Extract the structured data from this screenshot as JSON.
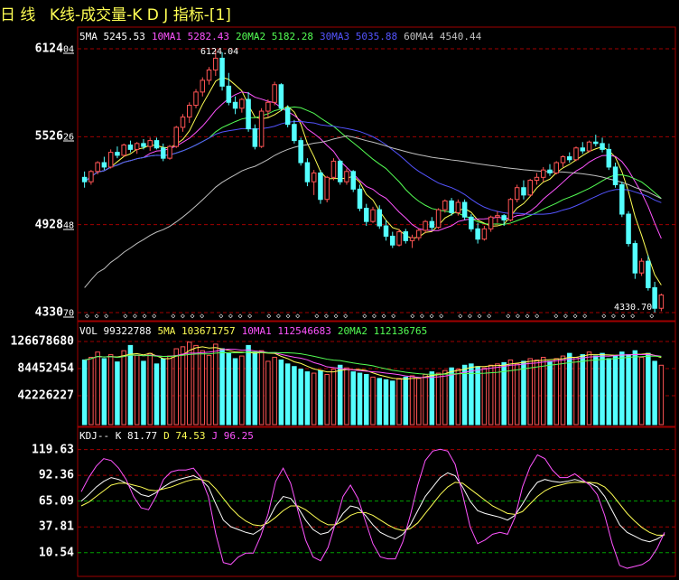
{
  "header": {
    "period": "日 线",
    "title": "K线-成交量-K D J 指标-[1]"
  },
  "price_legend": [
    {
      "text": "5MA 5245.53",
      "color": "#ffffff"
    },
    {
      "text": "10MA1 5282.43",
      "color": "#ff54ff"
    },
    {
      "text": "20MA2 5182.28",
      "color": "#54ff54"
    },
    {
      "text": "30MA3 5035.88",
      "color": "#5454ff"
    },
    {
      "text": "60MA4 4540.44",
      "color": "#c0c0c0"
    }
  ],
  "volume_legend": [
    {
      "text": "VOL 99322788",
      "color": "#ffffff"
    },
    {
      "text": "5MA 103671757",
      "color": "#ffff54"
    },
    {
      "text": "10MA1 112546683",
      "color": "#ff54ff"
    },
    {
      "text": "20MA2 112136765",
      "color": "#54ff54"
    }
  ],
  "kdj_legend": [
    {
      "text": "KDJ-- K 81.77",
      "color": "#ffffff"
    },
    {
      "text": "D 74.53",
      "color": "#ffff54"
    },
    {
      "text": "J 96.25",
      "color": "#ff54ff"
    }
  ],
  "price_axis": [
    {
      "main": "6124",
      "sub": "04"
    },
    {
      "main": "5526",
      "sub": "26"
    },
    {
      "main": "4928",
      "sub": "48"
    },
    {
      "main": "4330",
      "sub": "70"
    }
  ],
  "volume_axis": [
    "126678680",
    "84452454",
    "42226227"
  ],
  "kdj_axis": [
    "119.63",
    "92.36",
    "65.09",
    "37.81",
    "10.54"
  ],
  "annotations": {
    "high": "6124.04",
    "low": "4330.70"
  },
  "chart_data": [
    {
      "type": "candlestick",
      "title": "K线",
      "ylim": [
        4330.7,
        6124.04
      ],
      "ohlc": [
        [
          5250,
          5290,
          5180,
          5220
        ],
        [
          5220,
          5300,
          5200,
          5290
        ],
        [
          5290,
          5360,
          5270,
          5350
        ],
        [
          5350,
          5390,
          5300,
          5320
        ],
        [
          5320,
          5440,
          5310,
          5420
        ],
        [
          5420,
          5460,
          5380,
          5400
        ],
        [
          5400,
          5480,
          5390,
          5470
        ],
        [
          5470,
          5500,
          5420,
          5440
        ],
        [
          5440,
          5490,
          5410,
          5480
        ],
        [
          5480,
          5510,
          5440,
          5460
        ],
        [
          5460,
          5520,
          5430,
          5500
        ],
        [
          5500,
          5520,
          5440,
          5450
        ],
        [
          5450,
          5480,
          5360,
          5380
        ],
        [
          5380,
          5470,
          5370,
          5460
        ],
        [
          5460,
          5600,
          5450,
          5590
        ],
        [
          5590,
          5680,
          5560,
          5660
        ],
        [
          5660,
          5760,
          5620,
          5740
        ],
        [
          5740,
          5850,
          5720,
          5830
        ],
        [
          5830,
          5930,
          5800,
          5910
        ],
        [
          5910,
          6000,
          5880,
          5980
        ],
        [
          5980,
          6124.04,
          5940,
          6060
        ],
        [
          6060,
          6100,
          5840,
          5870
        ],
        [
          5870,
          5960,
          5740,
          5760
        ],
        [
          5760,
          5800,
          5680,
          5720
        ],
        [
          5720,
          5790,
          5690,
          5780
        ],
        [
          5780,
          5830,
          5560,
          5580
        ],
        [
          5580,
          5610,
          5440,
          5460
        ],
        [
          5460,
          5720,
          5450,
          5700
        ],
        [
          5700,
          5780,
          5660,
          5760
        ],
        [
          5760,
          5900,
          5740,
          5880
        ],
        [
          5880,
          5890,
          5700,
          5720
        ],
        [
          5720,
          5740,
          5590,
          5610
        ],
        [
          5610,
          5640,
          5480,
          5500
        ],
        [
          5500,
          5520,
          5330,
          5350
        ],
        [
          5350,
          5380,
          5190,
          5220
        ],
        [
          5220,
          5300,
          5130,
          5280
        ],
        [
          5280,
          5300,
          5070,
          5100
        ],
        [
          5100,
          5260,
          5080,
          5250
        ],
        [
          5250,
          5380,
          5230,
          5360
        ],
        [
          5360,
          5370,
          5200,
          5220
        ],
        [
          5220,
          5310,
          5200,
          5290
        ],
        [
          5290,
          5300,
          5150,
          5170
        ],
        [
          5170,
          5200,
          5020,
          5040
        ],
        [
          5040,
          5070,
          4920,
          4950
        ],
        [
          4950,
          5050,
          4940,
          5030
        ],
        [
          5030,
          5060,
          4900,
          4920
        ],
        [
          4920,
          4960,
          4820,
          4850
        ],
        [
          4850,
          4880,
          4770,
          4790
        ],
        [
          4790,
          4900,
          4780,
          4880
        ],
        [
          4880,
          4900,
          4800,
          4820
        ],
        [
          4820,
          4860,
          4770,
          4840
        ],
        [
          4840,
          4900,
          4820,
          4890
        ],
        [
          4890,
          4960,
          4870,
          4950
        ],
        [
          4950,
          4980,
          4890,
          4910
        ],
        [
          4910,
          5040,
          4900,
          5030
        ],
        [
          5030,
          5100,
          5010,
          5090
        ],
        [
          5090,
          5110,
          4990,
          5010
        ],
        [
          5010,
          5100,
          4990,
          5080
        ],
        [
          5080,
          5100,
          4960,
          4980
        ],
        [
          4980,
          5000,
          4880,
          4900
        ],
        [
          4900,
          4940,
          4800,
          4830
        ],
        [
          4830,
          4920,
          4820,
          4900
        ],
        [
          4900,
          4990,
          4880,
          4980
        ],
        [
          4980,
          5020,
          4940,
          4990
        ],
        [
          4990,
          5000,
          4920,
          4960
        ],
        [
          4960,
          5110,
          4950,
          5100
        ],
        [
          5100,
          5200,
          5080,
          5180
        ],
        [
          5180,
          5230,
          5100,
          5130
        ],
        [
          5130,
          5240,
          5120,
          5230
        ],
        [
          5230,
          5280,
          5200,
          5250
        ],
        [
          5250,
          5320,
          5220,
          5300
        ],
        [
          5300,
          5340,
          5260,
          5280
        ],
        [
          5280,
          5360,
          5270,
          5350
        ],
        [
          5350,
          5400,
          5320,
          5390
        ],
        [
          5390,
          5420,
          5350,
          5370
        ],
        [
          5370,
          5460,
          5360,
          5450
        ],
        [
          5450,
          5490,
          5410,
          5430
        ],
        [
          5430,
          5500,
          5420,
          5490
        ],
        [
          5490,
          5540,
          5460,
          5480
        ],
        [
          5480,
          5520,
          5420,
          5440
        ],
        [
          5440,
          5480,
          5300,
          5320
        ],
        [
          5320,
          5350,
          5180,
          5200
        ],
        [
          5200,
          5220,
          4980,
          5000
        ],
        [
          5000,
          5020,
          4780,
          4800
        ],
        [
          4800,
          4820,
          4560,
          4600
        ],
        [
          4600,
          4700,
          4580,
          4680
        ],
        [
          4680,
          4720,
          4480,
          4500
        ],
        [
          4500,
          4540,
          4330.7,
          4360
        ],
        [
          4360,
          4460,
          4340,
          4450
        ]
      ]
    },
    {
      "type": "bar",
      "title": "VOL",
      "ylim": [
        0,
        126678680
      ],
      "values": [
        98,
        102,
        110,
        100,
        106,
        95,
        112,
        120,
        105,
        96,
        108,
        92,
        100,
        104,
        115,
        118,
        125,
        120,
        112,
        105,
        122,
        115,
        108,
        100,
        104,
        120,
        110,
        112,
        96,
        102,
        98,
        92,
        88,
        84,
        80,
        78,
        82,
        76,
        84,
        90,
        86,
        80,
        78,
        76,
        72,
        70,
        68,
        66,
        70,
        72,
        74,
        70,
        76,
        80,
        78,
        82,
        86,
        84,
        90,
        92,
        88,
        86,
        90,
        92,
        94,
        98,
        92,
        96,
        100,
        98,
        102,
        96,
        100,
        104,
        108,
        102,
        106,
        110,
        104,
        108,
        100,
        104,
        110,
        106,
        112,
        102,
        108,
        96,
        90
      ],
      "ma5": [
        103671757
      ],
      "ma10": [
        112546683
      ],
      "ma20": [
        112136765
      ]
    },
    {
      "type": "line",
      "title": "KDJ",
      "ylim": [
        -5,
        125
      ],
      "series": [
        {
          "name": "K",
          "values": [
            65,
            72,
            80,
            86,
            90,
            88,
            84,
            78,
            72,
            70,
            74,
            80,
            85,
            88,
            90,
            92,
            88,
            80,
            62,
            45,
            38,
            35,
            32,
            30,
            35,
            45,
            60,
            70,
            68,
            58,
            45,
            35,
            30,
            32,
            40,
            52,
            60,
            58,
            50,
            40,
            32,
            28,
            25,
            30,
            40,
            55,
            70,
            80,
            90,
            95,
            92,
            80,
            65,
            55,
            52,
            50,
            48,
            45,
            50,
            62,
            75,
            85,
            88,
            86,
            85,
            86,
            88,
            86,
            84,
            80,
            70,
            55,
            40,
            32,
            28,
            24,
            22,
            25,
            30
          ]
        },
        {
          "name": "D",
          "values": [
            60,
            64,
            70,
            76,
            82,
            84,
            84,
            82,
            80,
            77,
            76,
            78,
            80,
            83,
            86,
            88,
            88,
            86,
            78,
            68,
            58,
            50,
            44,
            40,
            39,
            42,
            48,
            55,
            60,
            60,
            56,
            50,
            44,
            40,
            40,
            44,
            50,
            53,
            53,
            50,
            45,
            40,
            36,
            34,
            36,
            42,
            52,
            62,
            72,
            80,
            85,
            84,
            78,
            72,
            66,
            60,
            56,
            52,
            51,
            54,
            62,
            70,
            76,
            80,
            82,
            84,
            85,
            85,
            85,
            84,
            80,
            72,
            62,
            52,
            44,
            37,
            32,
            29,
            29
          ]
        },
        {
          "name": "J",
          "values": [
            75,
            90,
            102,
            110,
            108,
            100,
            88,
            70,
            58,
            56,
            70,
            88,
            96,
            98,
            98,
            100,
            90,
            70,
            30,
            0,
            -2,
            6,
            10,
            10,
            28,
            52,
            86,
            100,
            84,
            54,
            24,
            6,
            2,
            16,
            42,
            70,
            82,
            68,
            44,
            20,
            6,
            4,
            4,
            22,
            50,
            82,
            108,
            118,
            120,
            118,
            104,
            72,
            38,
            20,
            24,
            30,
            32,
            30,
            48,
            80,
            101,
            114,
            110,
            98,
            90,
            90,
            94,
            88,
            82,
            72,
            50,
            20,
            -3,
            -6,
            -4,
            -2,
            3,
            15,
            32
          ]
        }
      ]
    }
  ]
}
